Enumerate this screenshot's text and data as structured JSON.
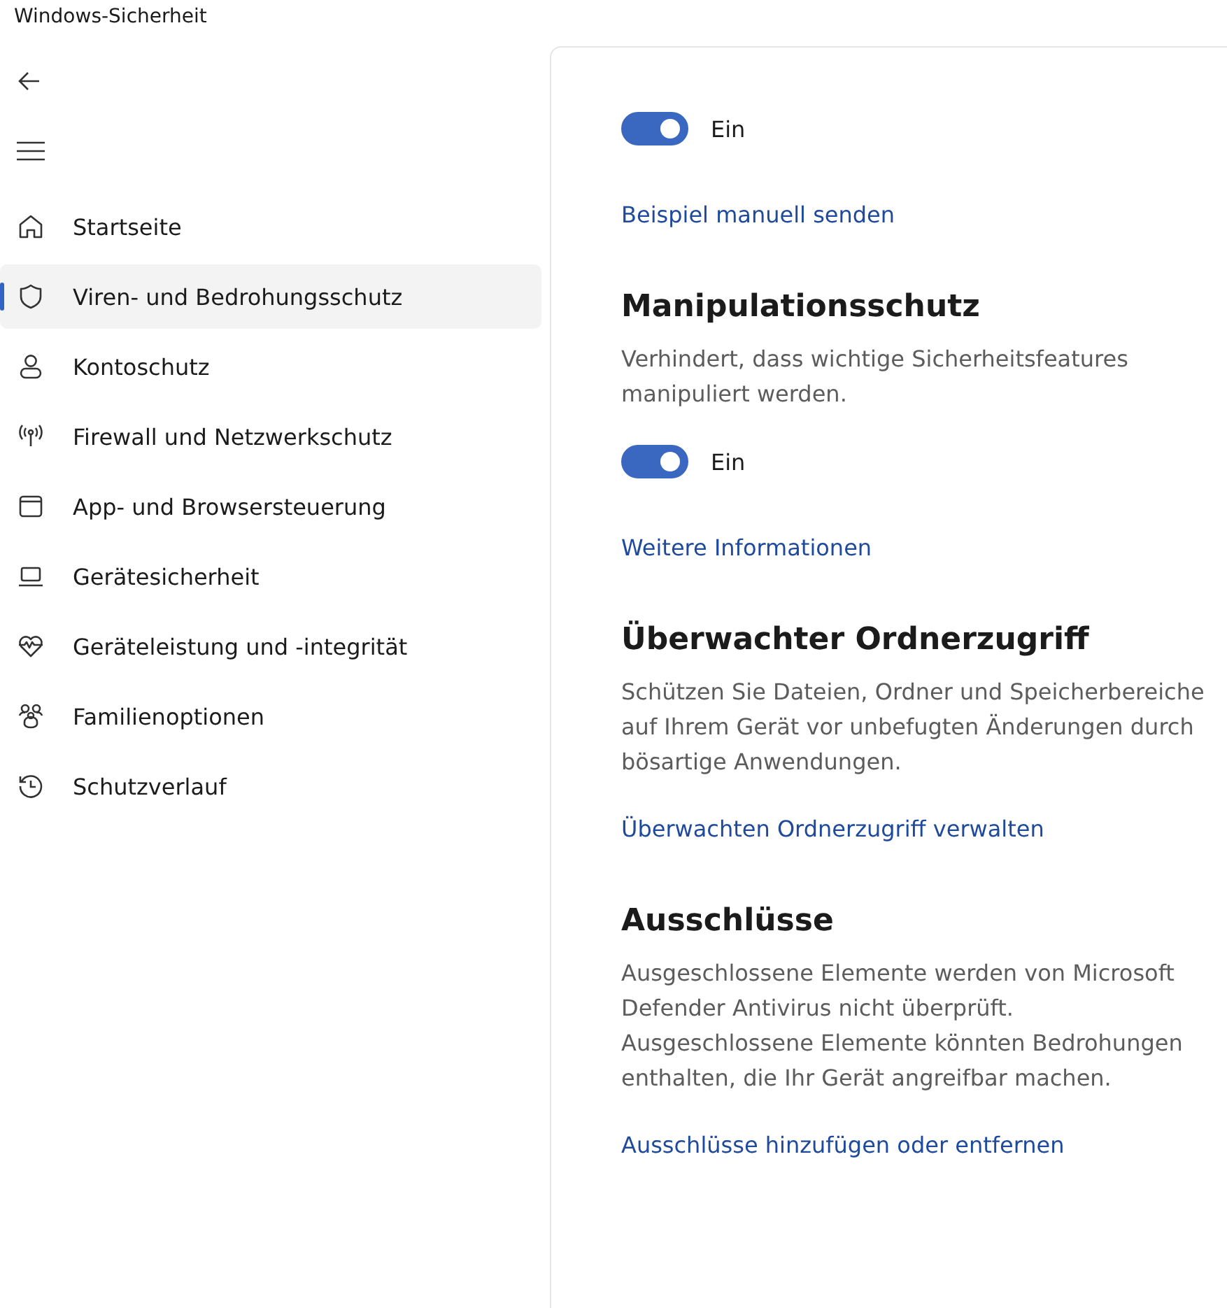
{
  "window": {
    "title": "Windows-Sicherheit"
  },
  "sidebar": {
    "items": [
      {
        "label": "Startseite",
        "selected": false
      },
      {
        "label": "Viren- und Bedrohungsschutz",
        "selected": true
      },
      {
        "label": "Kontoschutz",
        "selected": false
      },
      {
        "label": "Firewall und Netzwerkschutz",
        "selected": false
      },
      {
        "label": "App- und Browsersteuerung",
        "selected": false
      },
      {
        "label": "Gerätesicherheit",
        "selected": false
      },
      {
        "label": "Geräteleistung und -integrität",
        "selected": false
      },
      {
        "label": "Familienoptionen",
        "selected": false
      },
      {
        "label": "Schutzverlauf",
        "selected": false
      }
    ]
  },
  "sections": [
    {
      "toggle": {
        "on": true,
        "label": "Ein"
      },
      "link": "Beispiel manuell senden"
    },
    {
      "title": "Manipulationsschutz",
      "description": "Verhindert, dass wichtige Sicherheitsfeatures manipuliert werden.",
      "toggle": {
        "on": true,
        "label": "Ein"
      },
      "link": "Weitere Informationen"
    },
    {
      "title": "Überwachter Ordnerzugriff",
      "description": "Schützen Sie Dateien, Ordner und Speicherbereiche auf Ihrem Gerät vor unbefugten Änderungen durch bösartige Anwendungen.",
      "link": "Überwachten Ordnerzugriff verwalten"
    },
    {
      "title": "Ausschlüsse",
      "description": "Ausgeschlossene Elemente werden von Microsoft Defender Antivirus nicht überprüft. Ausgeschlossene Elemente könnten Bedrohungen enthalten, die Ihr Gerät angreifbar machen.",
      "link": "Ausschlüsse hinzufügen oder entfernen"
    }
  ]
}
